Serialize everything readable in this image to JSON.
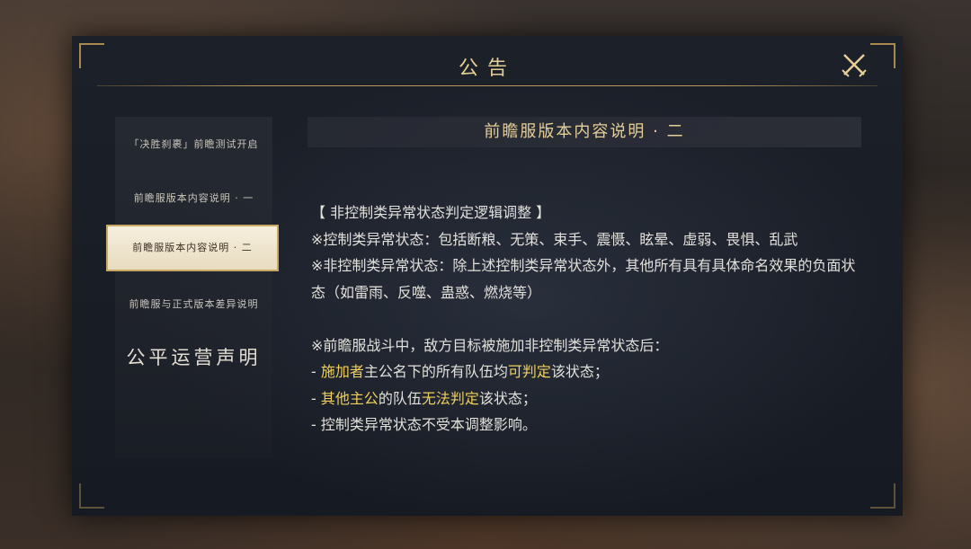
{
  "dialog": {
    "title": "公告"
  },
  "sidebar": {
    "items": [
      {
        "label": "「决胜刹裹」前瞻测试开启"
      },
      {
        "label": "前瞻服版本内容说明 · 一"
      },
      {
        "label": "前瞻服版本内容说明 · 二"
      },
      {
        "label": "前瞻服与正式版本差异说明"
      },
      {
        "label": "公平运营声明"
      }
    ],
    "active_index": 2
  },
  "content": {
    "title": "前瞻服版本内容说明 · 二",
    "heading": "【 非控制类异常状态判定逻辑调整 】",
    "para1": "※控制类异常状态：包括断粮、无策、束手、震慑、眩晕、虚弱、畏惧、乱武",
    "para2": "※非控制类异常状态：除上述控制类异常状态外，其他所有具有具体命名效果的负面状态（如雷雨、反噬、蛊惑、燃烧等）",
    "para3": "※前瞻服战斗中，敌方目标被施加非控制类异常状态后：",
    "bullet1": {
      "prefix": "- ",
      "hl1": "施加者",
      "mid": "主公名下的所有队伍均",
      "hl2": "可判定",
      "suffix": "该状态；"
    },
    "bullet2": {
      "prefix": "- ",
      "hl1": "其他主公",
      "mid": "的队伍",
      "hl2": "无法判定",
      "suffix": "该状态；"
    },
    "bullet3": "- 控制类异常状态不受本调整影响。"
  },
  "colors": {
    "accent_gold": "#e6cf97",
    "highlight": "#f0cf5c",
    "text": "#e2e0da"
  }
}
